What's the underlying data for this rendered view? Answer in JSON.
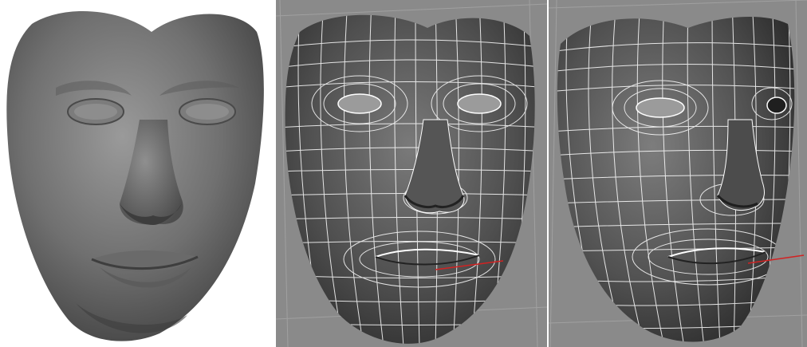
{
  "image": {
    "panels": [
      {
        "id": "smooth-shaded-head",
        "background": "#ffffff",
        "surface_color": "#6b6b6b"
      },
      {
        "id": "wireframe-front-view",
        "background": "#8a8a8a",
        "surface_color": "#555555",
        "wire_color": "#ffffff",
        "axis_color": "#d22222"
      },
      {
        "id": "wireframe-three-quarter-view",
        "background": "#8a8a8a",
        "surface_color": "#555555",
        "wire_color": "#ffffff",
        "axis_color": "#d22222"
      }
    ]
  }
}
